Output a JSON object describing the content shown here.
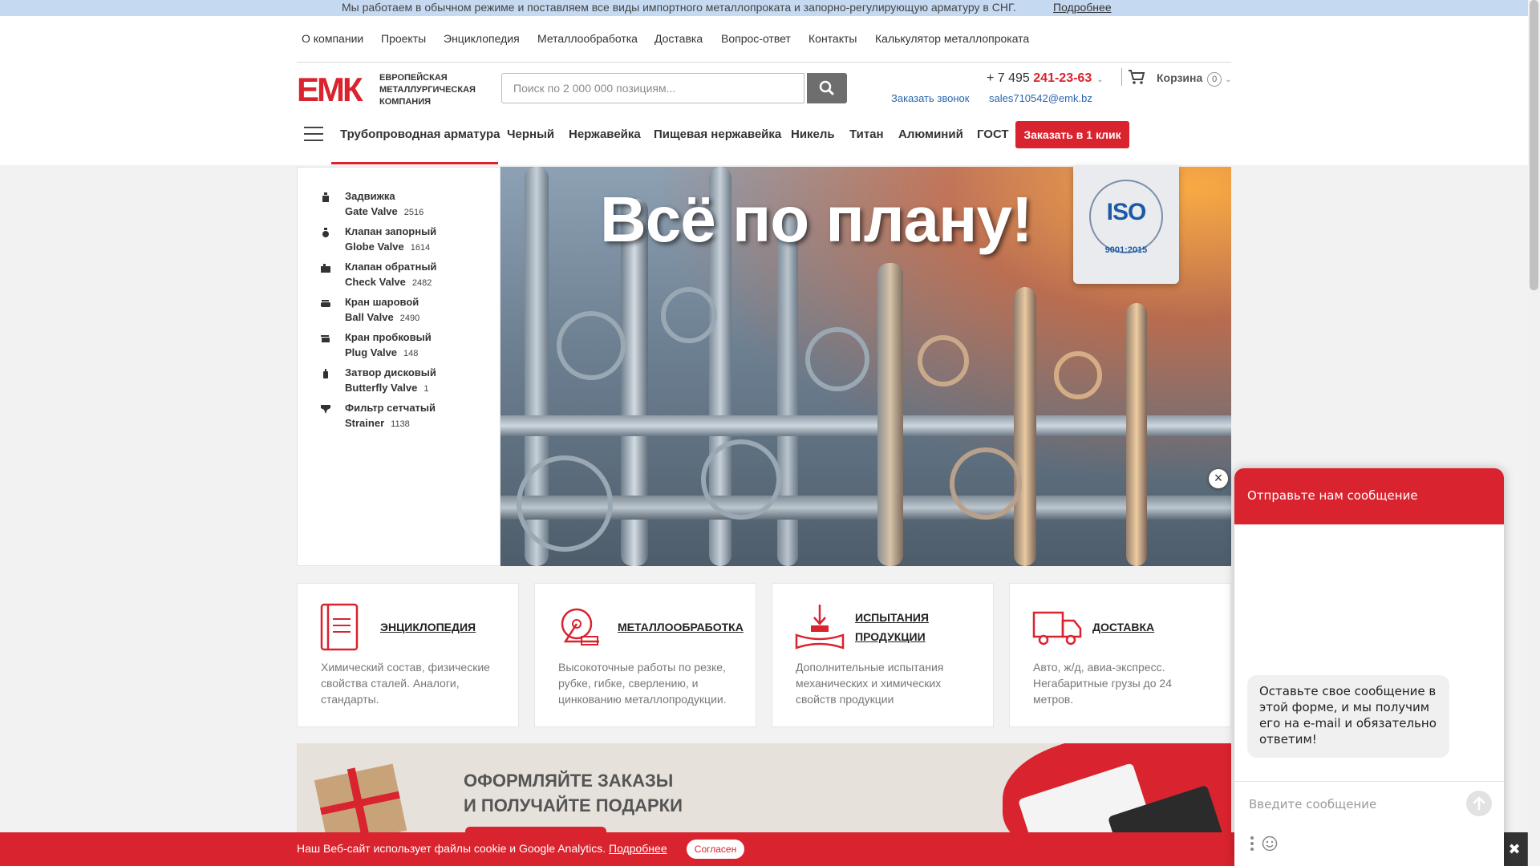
{
  "notice": {
    "text": "Мы работаем в обычном режиме и поставляем все виды импортного металлопроката и запорно-регулирующую арматуру в СНГ.",
    "more": "Подробнее"
  },
  "top_nav": [
    "О компании",
    "Проекты",
    "Энциклопедия",
    "Металлообработка",
    "Доставка",
    "Вопрос-ответ",
    "Контакты",
    "Калькулятор металлопроката"
  ],
  "logo": {
    "letters": "ЕМК",
    "line1": "ЕВРОПЕЙСКАЯ",
    "line2": "МЕТАЛЛУРГИЧЕСКАЯ",
    "line3": "КОМПАНИЯ"
  },
  "search": {
    "placeholder": "Поиск по 2 000 000 позициям..."
  },
  "contacts": {
    "phone_prefix": "+ 7 495 ",
    "phone_number": "241-23-63",
    "callback": "Заказать звонок",
    "email": "sales710542@emk.bz"
  },
  "cart": {
    "label": "Корзина",
    "count": "0"
  },
  "category_nav": {
    "items": [
      "Трубопроводная арматура",
      "Черный",
      "Нержавейка",
      "Пищевая нержавейка",
      "Никель",
      "Титан",
      "Алюминий",
      "ГОСТ"
    ],
    "order_button": "Заказать в 1 клик"
  },
  "left_menu": [
    {
      "ru": "Задвижка",
      "en": "Gate Valve",
      "count": "2516"
    },
    {
      "ru": "Клапан запорный",
      "en": "Globe Valve",
      "count": "1614"
    },
    {
      "ru": "Клапан обратный",
      "en": "Check Valve",
      "count": "2482"
    },
    {
      "ru": "Кран шаровой",
      "en": "Ball Valve",
      "count": "2490"
    },
    {
      "ru": "Кран пробковый",
      "en": "Plug Valve",
      "count": "148"
    },
    {
      "ru": "Затвор дисковый",
      "en": "Butterfly Valve",
      "count": "1"
    },
    {
      "ru": "Фильтр сетчатый",
      "en": "Strainer",
      "count": "1138"
    }
  ],
  "banner": {
    "title": "Всё по плану!",
    "iso_word": "ISO",
    "iso_standard": "9001:2015"
  },
  "service_cards": [
    {
      "title": "ЭНЦИКЛОПЕДИЯ",
      "description": "Химический состав, физические свойства сталей. Аналоги, стандарты.",
      "icon": "book-icon"
    },
    {
      "title": "МЕТАЛЛООБРАБОТКА",
      "description": "Высокоточные работы по резке, рубке, гибке, сверлению, и цинкованию металлопродукции.",
      "icon": "cutting-saw-icon"
    },
    {
      "title_line1": "ИСПЫТАНИЯ",
      "title_line2": "ПРОДУКЦИИ",
      "description": "Дополнительные испытания механических и химических свойств продукции",
      "icon": "press-test-icon"
    },
    {
      "title": "ДОСТАВКА",
      "description": "Авто, ж/д, авиа-экспресс. Негабаритные грузы до 24 метров.",
      "icon": "truck-icon"
    }
  ],
  "promo": {
    "line1": "ОФОРМЛЯЙТЕ ЗАКАЗЫ",
    "line2": "И ПОЛУЧАЙТЕ ПОДАРКИ"
  },
  "cookie": {
    "text": "Наш Веб-сайт использует файлы cookie и Google Analytics.",
    "more": "Подробнее",
    "agree": "Согласен",
    "close": "✖"
  },
  "chat": {
    "title": "Отправьте нам сообщение",
    "bubble": "Оставьте свое сообщение в этой форме, и мы получим его на e-mail и обязательно ответим!",
    "input_placeholder": "Введите сообщение",
    "close": "×"
  },
  "colors": {
    "accent": "#d9232e",
    "link": "#2a65ad",
    "notice_bg": "#c5daf1",
    "page_bg": "#f2f2f2"
  }
}
